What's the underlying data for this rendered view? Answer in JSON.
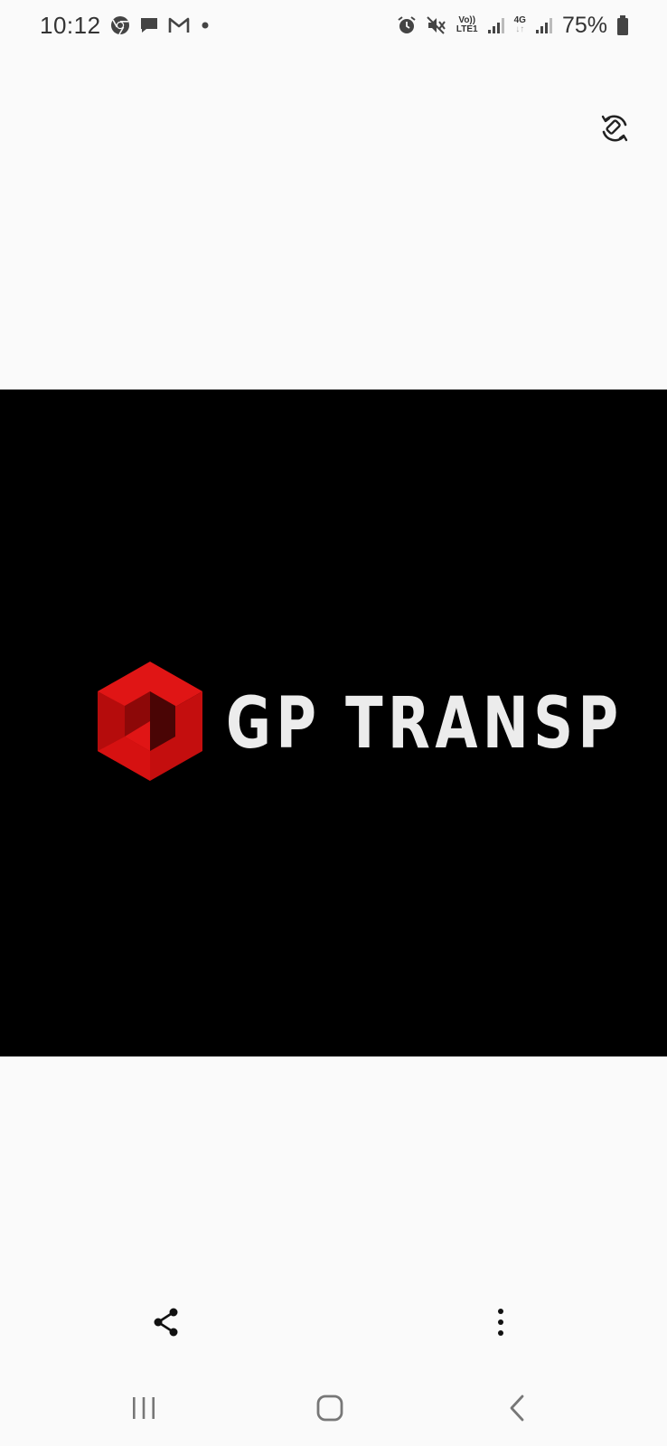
{
  "status_bar": {
    "time": "10:12",
    "left_icons": [
      "chrome-icon",
      "chat-icon",
      "gmail-icon",
      "dot-icon"
    ],
    "right_icons": [
      "alarm-icon",
      "mute-icon",
      "volte-icon",
      "signal-icon",
      "4g-icon",
      "signal-icon",
      "battery-icon"
    ],
    "volte_top": "Vo))",
    "volte_bottom": "LTE1",
    "network": "4G",
    "battery": "75%"
  },
  "toolbar": {
    "rotate_icon": "rotate-icon"
  },
  "image": {
    "background": "#000000",
    "logo_text": "GP TRANSP",
    "logo_color": "#d10d0d"
  },
  "actions": {
    "share_icon": "share-icon",
    "more_icon": "more-vertical-icon"
  },
  "nav": {
    "recents_icon": "recents-icon",
    "home_icon": "home-icon",
    "back_icon": "back-icon"
  }
}
